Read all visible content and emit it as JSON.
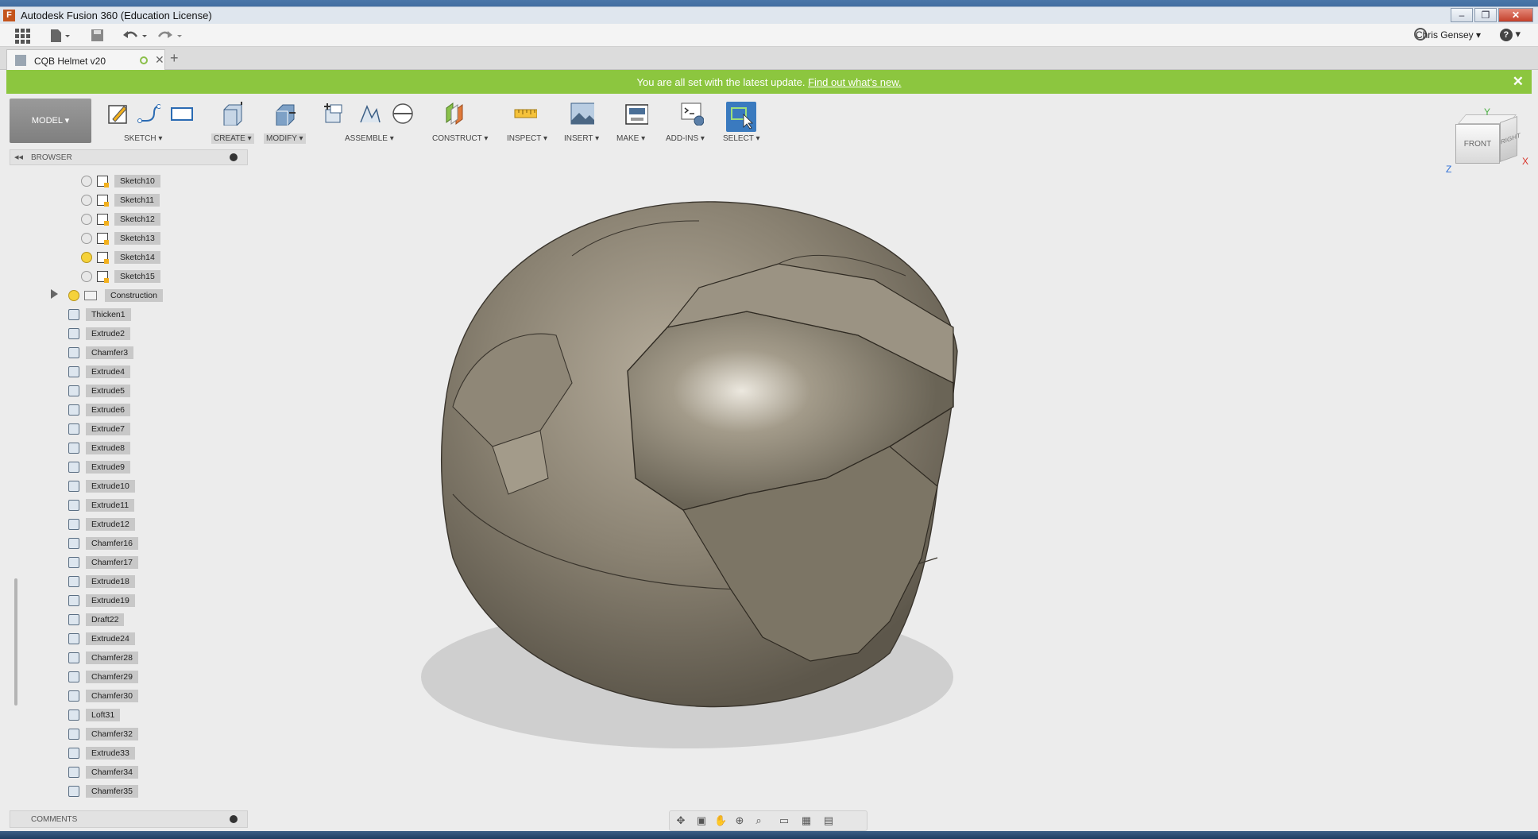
{
  "window": {
    "title": "Autodesk Fusion 360 (Education License)",
    "minimize": "–",
    "restore": "❐",
    "close": "✕"
  },
  "quickaccess": {
    "user": "Chris Gensey ▾",
    "help": "?",
    "help_caret": "▾"
  },
  "tabs": {
    "doc_name": "CQB Helmet v20",
    "close": "✕",
    "new_tab": "+"
  },
  "banner": {
    "message": "You are all set with the latest update.",
    "link": "Find out what's new.",
    "close": "✕"
  },
  "toolbar": {
    "model": "MODEL ▾",
    "groups": [
      {
        "label": "SKETCH ▾"
      },
      {
        "label": "CREATE ▾"
      },
      {
        "label": "MODIFY ▾"
      },
      {
        "label": "ASSEMBLE ▾"
      },
      {
        "label": "CONSTRUCT ▾"
      },
      {
        "label": "INSPECT ▾"
      },
      {
        "label": "INSERT ▾"
      },
      {
        "label": "MAKE ▾"
      },
      {
        "label": "ADD-INS ▾"
      },
      {
        "label": "SELECT ▾"
      }
    ]
  },
  "browser": {
    "title": "BROWSER",
    "sketches": [
      "Sketch10",
      "Sketch11",
      "Sketch12",
      "Sketch13",
      "Sketch14",
      "Sketch15"
    ],
    "folder": "Construction",
    "features": [
      "Thicken1",
      "Extrude2",
      "Chamfer3",
      "Extrude4",
      "Extrude5",
      "Extrude6",
      "Extrude7",
      "Extrude8",
      "Extrude9",
      "Extrude10",
      "Extrude11",
      "Extrude12",
      "Chamfer16",
      "Chamfer17",
      "Extrude18",
      "Extrude19",
      "Draft22",
      "Extrude24",
      "Chamfer28",
      "Chamfer29",
      "Chamfer30",
      "Loft31",
      "Chamfer32",
      "Extrude33",
      "Chamfer34",
      "Chamfer35"
    ]
  },
  "comments": {
    "title": "COMMENTS"
  },
  "viewcube": {
    "front": "FRONT",
    "right": "RIGHT",
    "x": "X",
    "y": "Y",
    "z": "Z"
  },
  "colors": {
    "banner": "#8cc63f",
    "select_active": "#3a7abf",
    "helmet": "#8a8272"
  }
}
